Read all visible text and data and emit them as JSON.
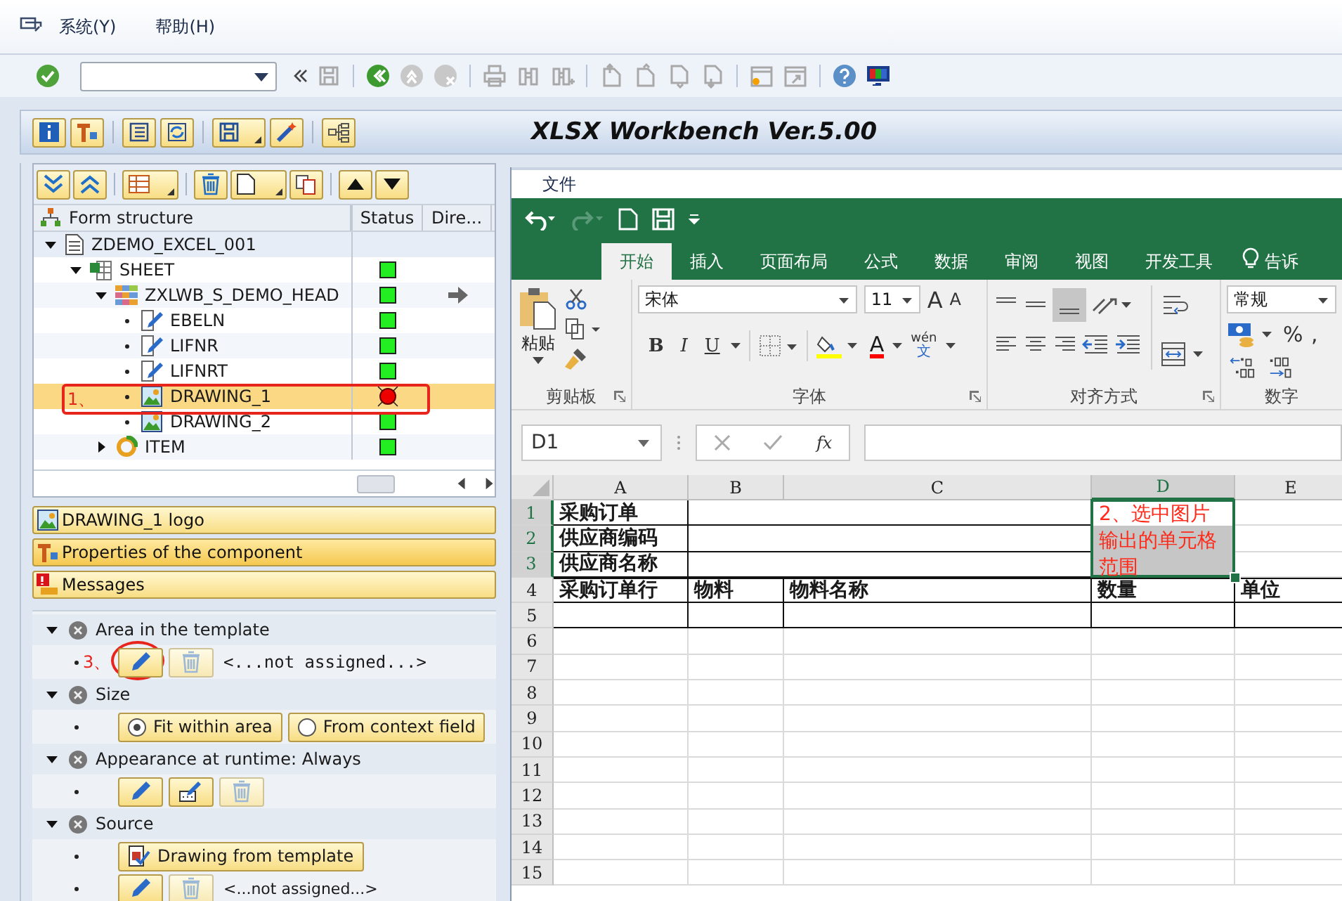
{
  "menu": [
    {
      "label": "系统(Y)"
    },
    {
      "label": "帮助(H)"
    }
  ],
  "app_title": "XLSX Workbench Ver.5.00",
  "tree": {
    "columns": [
      "Form structure",
      "Status",
      "Dire..."
    ],
    "nodes": [
      {
        "label": "ZDEMO_EXCEL_001",
        "kind": "form",
        "expanded": true,
        "selected": false,
        "children": [
          {
            "label": "SHEET",
            "kind": "sheet",
            "error": false,
            "expanded": true,
            "selected": false,
            "children": [
              {
                "label": "ZXLWB_S_DEMO_HEAD",
                "kind": "table",
                "error": false,
                "arrow": true,
                "expanded": true,
                "selected": false,
                "children": [
                  {
                    "label": "EBELN",
                    "kind": "field",
                    "error": false,
                    "selected": false
                  },
                  {
                    "label": "LIFNR",
                    "kind": "field",
                    "error": false,
                    "selected": false
                  },
                  {
                    "label": "LIFNRT",
                    "kind": "field",
                    "error": false,
                    "selected": false
                  },
                  {
                    "label": "DRAWING_1",
                    "kind": "drawing",
                    "error": true,
                    "selected": true,
                    "callout": "1、"
                  },
                  {
                    "label": "DRAWING_2",
                    "kind": "drawing",
                    "error": false,
                    "selected": false
                  }
                ]
              },
              {
                "label": "ITEM",
                "kind": "loop",
                "error": false,
                "expanded": false,
                "selected": false
              }
            ]
          }
        ]
      }
    ]
  },
  "panels": [
    {
      "label": "DRAWING_1  logo",
      "kind": "drawing",
      "selected": false
    },
    {
      "label": "Properties of the component",
      "kind": "properties",
      "selected": true
    },
    {
      "label": "Messages",
      "kind": "messages",
      "selected": false
    }
  ],
  "sections": [
    {
      "title": "Area in the template",
      "expanded": true,
      "rows": [
        {
          "callout": "3、",
          "items": [
            {
              "kind": "edit"
            },
            {
              "kind": "delete",
              "disabled": true
            },
            {
              "kind": "code-text",
              "text": "<...not assigned...>"
            }
          ]
        }
      ]
    },
    {
      "title": "Size",
      "expanded": true,
      "rows": [
        {
          "items": [
            {
              "kind": "radio",
              "label": "Fit within area",
              "selected": true
            },
            {
              "kind": "radio",
              "label": "From context field",
              "selected": false
            }
          ]
        }
      ]
    },
    {
      "title": "Appearance at runtime: Always",
      "expanded": true,
      "rows": [
        {
          "items": [
            {
              "kind": "edit"
            },
            {
              "kind": "edit-list"
            },
            {
              "kind": "delete",
              "disabled": true
            }
          ]
        }
      ]
    },
    {
      "title": "Source",
      "expanded": true,
      "rows": [
        {
          "items": [
            {
              "kind": "doc-button",
              "label": "Drawing from template"
            }
          ]
        },
        {
          "items": [
            {
              "kind": "edit"
            },
            {
              "kind": "delete",
              "disabled": true
            },
            {
              "kind": "text",
              "text": "<...not assigned...>"
            }
          ]
        }
      ]
    }
  ],
  "excel": {
    "file_menu": "文件",
    "tabs": [
      {
        "label": "开始",
        "selected": true
      },
      {
        "label": "插入",
        "selected": false
      },
      {
        "label": "页面布局",
        "selected": false
      },
      {
        "label": "公式",
        "selected": false
      },
      {
        "label": "数据",
        "selected": false
      },
      {
        "label": "审阅",
        "selected": false
      },
      {
        "label": "视图",
        "selected": false
      },
      {
        "label": "开发工具",
        "selected": false
      }
    ],
    "tell_me": "告诉",
    "ribbon": {
      "paste": "粘贴",
      "font": "宋体",
      "size": "11",
      "grow": "A",
      "shrink": "A",
      "styles": [
        "B",
        "I",
        "U"
      ],
      "font_color": "A",
      "phonetic": "wén",
      "phonetic_char": "文",
      "number_format": "常规",
      "percent": "%",
      "comma": ",",
      "groups": [
        "剪贴板",
        "字体",
        "对齐方式",
        "数字"
      ]
    },
    "name_box": "D1",
    "fx": "fx",
    "columns": [
      {
        "label": "A",
        "selected": false
      },
      {
        "label": "B",
        "selected": false
      },
      {
        "label": "C",
        "selected": false
      },
      {
        "label": "D",
        "selected": true
      },
      {
        "label": "E",
        "selected": false
      }
    ],
    "rows": [
      {
        "label": "1",
        "selected": true
      },
      {
        "label": "2",
        "selected": true
      },
      {
        "label": "3",
        "selected": true
      },
      {
        "label": "4",
        "selected": false
      },
      {
        "label": "5",
        "selected": false
      },
      {
        "label": "6",
        "selected": false
      },
      {
        "label": "7",
        "selected": false
      },
      {
        "label": "8",
        "selected": false
      },
      {
        "label": "9",
        "selected": false
      },
      {
        "label": "10",
        "selected": false
      },
      {
        "label": "11",
        "selected": false
      },
      {
        "label": "12",
        "selected": false
      },
      {
        "label": "13",
        "selected": false
      },
      {
        "label": "14",
        "selected": false
      },
      {
        "label": "15",
        "selected": false
      }
    ],
    "header_rows": [
      "采购订单",
      "供应商编码",
      "供应商名称"
    ],
    "table_header": [
      "采购订单行",
      "物料",
      "物料名称",
      "数量",
      "单位"
    ],
    "selection_note": [
      "2、选中图片",
      "输出的单元格",
      "范围"
    ]
  }
}
